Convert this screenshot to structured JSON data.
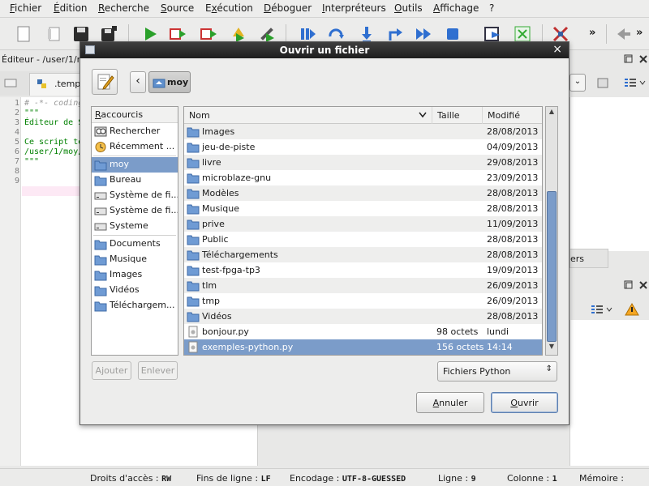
{
  "menu": {
    "items": [
      "Fichier",
      "Édition",
      "Recherche",
      "Source",
      "Exécution",
      "Déboguer",
      "Interpréteurs",
      "Outils",
      "Affichage",
      "?"
    ],
    "underline_chars": [
      "F",
      "É",
      "R",
      "S",
      "x",
      "D",
      "I",
      "O",
      "A",
      ""
    ]
  },
  "editor": {
    "title": "Éditeur - /user/1/m",
    "tab_label": ".temp",
    "line_numbers": [
      "1",
      "2",
      "3",
      "4",
      "5",
      "6",
      "7",
      "8",
      "9"
    ],
    "lines": [
      "# -*- coding",
      "\"\"\"",
      "Éditeur de S",
      "",
      "Ce script te",
      "/user/1/moy/",
      "\"\"\"",
      "",
      ""
    ],
    "right_tab_label": "ers"
  },
  "status": {
    "access_label": "Droits d'accès :",
    "access_value": "RW",
    "eol_label": "Fins de ligne :",
    "eol_value": "LF",
    "encoding_label": "Encodage :",
    "encoding_value": "UTF-8-GUESSED",
    "line_label": "Ligne :",
    "line_value": "9",
    "column_label": "Colonne :",
    "column_value": "1",
    "memory_label": "Mémoire :"
  },
  "dialog": {
    "title": "Ouvrir un fichier",
    "close_glyph": "×",
    "back_glyph": "‹",
    "current_folder": "moy",
    "places_header": "Raccourcis",
    "places": [
      {
        "label": "Rechercher",
        "icon": "search-icon"
      },
      {
        "label": "Récemment ...",
        "icon": "recent-icon"
      },
      {
        "label": "moy",
        "icon": "home-folder-icon",
        "selected": true
      },
      {
        "label": "Bureau",
        "icon": "desktop-folder-icon"
      },
      {
        "label": "Système de fi...",
        "icon": "drive-icon"
      },
      {
        "label": "Système de fi...",
        "icon": "drive-icon"
      },
      {
        "label": "Systeme",
        "icon": "drive-icon"
      },
      {
        "label": "Documents",
        "icon": "documents-folder-icon"
      },
      {
        "label": "Musique",
        "icon": "music-folder-icon"
      },
      {
        "label": "Images",
        "icon": "pictures-folder-icon"
      },
      {
        "label": "Vidéos",
        "icon": "videos-folder-icon"
      },
      {
        "label": "Téléchargem...",
        "icon": "downloads-folder-icon"
      }
    ],
    "add_button": "Ajouter",
    "remove_button": "Enlever",
    "columns": {
      "name": "Nom",
      "size": "Taille",
      "modified": "Modifié"
    },
    "files": [
      {
        "name": "Images",
        "size": "",
        "modified": "28/08/2013",
        "type": "folder"
      },
      {
        "name": "jeu-de-piste",
        "size": "",
        "modified": "04/09/2013",
        "type": "folder"
      },
      {
        "name": "livre",
        "size": "",
        "modified": "29/08/2013",
        "type": "folder"
      },
      {
        "name": "microblaze-gnu",
        "size": "",
        "modified": "23/09/2013",
        "type": "folder"
      },
      {
        "name": "Modèles",
        "size": "",
        "modified": "28/08/2013",
        "type": "folder"
      },
      {
        "name": "Musique",
        "size": "",
        "modified": "28/08/2013",
        "type": "folder"
      },
      {
        "name": "prive",
        "size": "",
        "modified": "11/09/2013",
        "type": "folder"
      },
      {
        "name": "Public",
        "size": "",
        "modified": "28/08/2013",
        "type": "folder"
      },
      {
        "name": "Téléchargements",
        "size": "",
        "modified": "28/08/2013",
        "type": "folder"
      },
      {
        "name": "test-fpga-tp3",
        "size": "",
        "modified": "19/09/2013",
        "type": "folder"
      },
      {
        "name": "tlm",
        "size": "",
        "modified": "26/09/2013",
        "type": "folder"
      },
      {
        "name": "tmp",
        "size": "",
        "modified": "26/09/2013",
        "type": "folder"
      },
      {
        "name": "Vidéos",
        "size": "",
        "modified": "28/08/2013",
        "type": "folder"
      },
      {
        "name": "bonjour.py",
        "size": "98 octets",
        "modified": "lundi",
        "type": "file"
      },
      {
        "name": "exemples-python.py",
        "size": "156 octets",
        "modified": "14:14",
        "type": "file",
        "selected": true
      }
    ],
    "filter_value": "Fichiers Python",
    "filter_arrow": "⇕",
    "cancel_button": "Annuler",
    "open_button": "Ouvrir"
  },
  "colors": {
    "selection": "#7b9cc9",
    "folder": "#5f8fcc"
  }
}
